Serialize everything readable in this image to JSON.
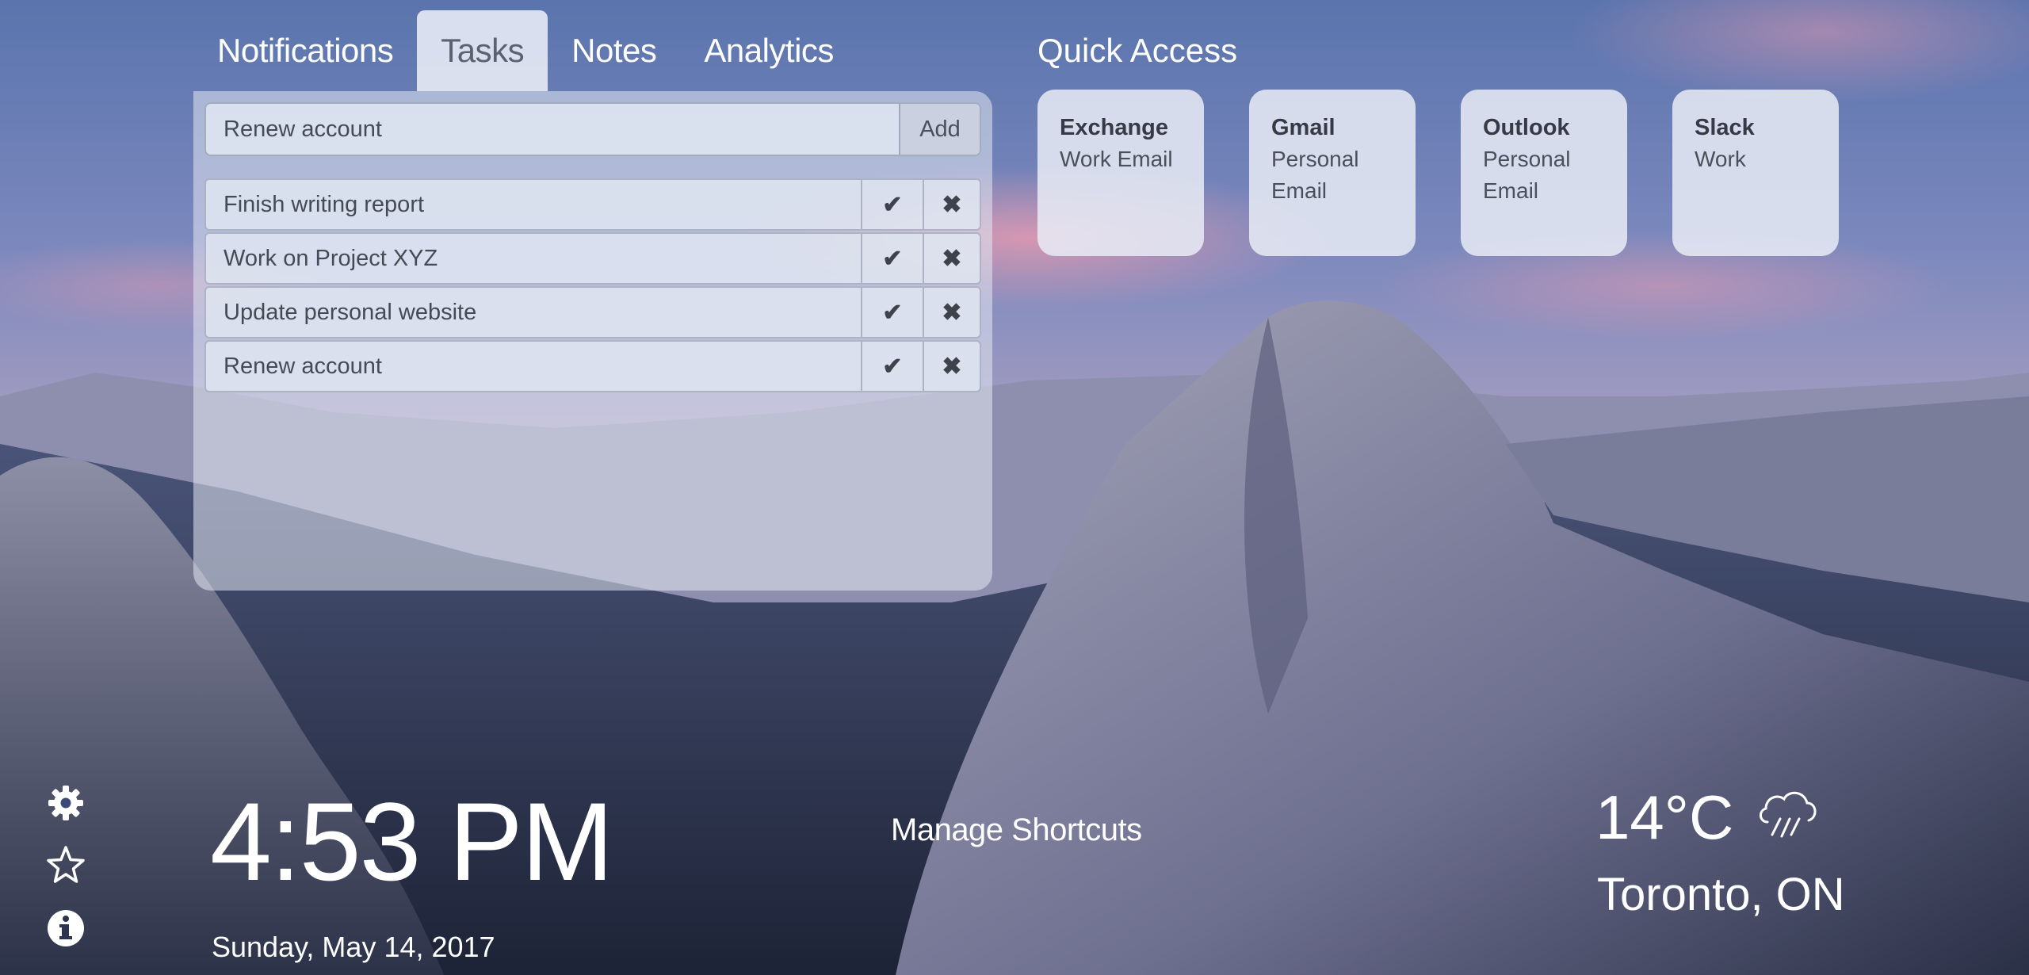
{
  "tabs": [
    {
      "label": "Notifications",
      "active": false
    },
    {
      "label": "Tasks",
      "active": true
    },
    {
      "label": "Notes",
      "active": false
    },
    {
      "label": "Analytics",
      "active": false
    }
  ],
  "tasks_panel": {
    "new_task_value": "Renew account",
    "add_label": "Add",
    "done_icon": "checkmark-icon",
    "delete_icon": "x-icon",
    "items": [
      {
        "label": "Finish writing report"
      },
      {
        "label": "Work on Project XYZ"
      },
      {
        "label": "Update personal website"
      },
      {
        "label": "Renew account"
      }
    ]
  },
  "quick_access": {
    "title": "Quick Access",
    "cards": [
      {
        "title": "Exchange",
        "subtitle": "Work Email"
      },
      {
        "title": "Gmail",
        "subtitle": "Personal Email"
      },
      {
        "title": "Outlook",
        "subtitle": "Personal Email"
      },
      {
        "title": "Slack",
        "subtitle": "Work"
      }
    ]
  },
  "side_icons": [
    "gear-icon",
    "star-icon",
    "info-icon"
  ],
  "clock": {
    "time": "4:53 PM",
    "date": "Sunday, May 14, 2017"
  },
  "manage_shortcuts_label": "Manage Shortcuts",
  "weather": {
    "temperature": "14°C",
    "location": "Toronto, ON",
    "icon": "cloud-rain-icon"
  },
  "colors": {
    "accent_panel": "#e4e8f3",
    "text_dark": "#454b55",
    "sky_top": "#5e7bb3",
    "sky_pink": "#c98aa6"
  }
}
